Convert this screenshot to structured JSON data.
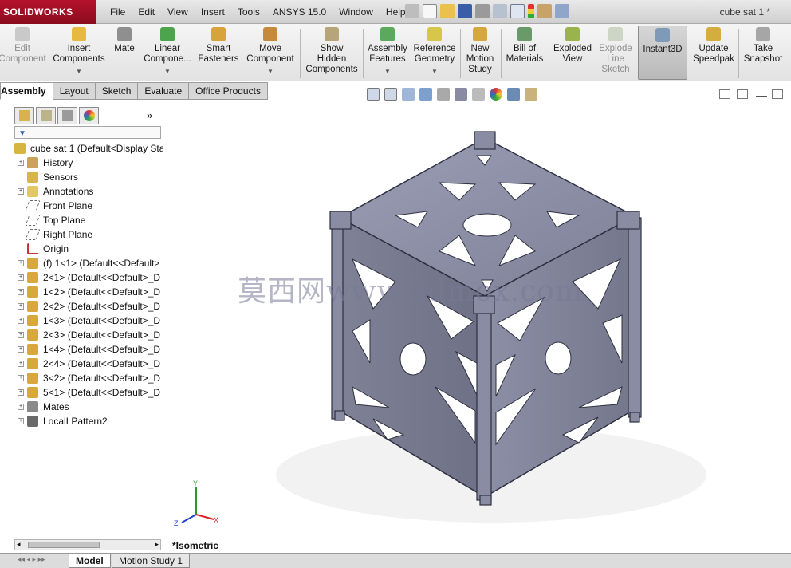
{
  "app": {
    "brand": "SOLIDWORKS",
    "doc_title": "cube sat 1 *"
  },
  "menu": [
    "File",
    "Edit",
    "View",
    "Insert",
    "Tools",
    "ANSYS 15.0",
    "Window",
    "Help"
  ],
  "ribbon": {
    "edit_component": "Edit\nComponent",
    "insert_components": "Insert\nComponents",
    "mate": "Mate",
    "linear_component": "Linear\nCompone...",
    "smart_fasteners": "Smart\nFasteners",
    "move_component": "Move\nComponent",
    "show_hidden": "Show\nHidden\nComponents",
    "assembly_features": "Assembly\nFeatures",
    "reference_geometry": "Reference\nGeometry",
    "new_motion_study": "New\nMotion\nStudy",
    "bill_of_materials": "Bill of\nMaterials",
    "exploded_view": "Exploded\nView",
    "explode_line_sketch": "Explode\nLine\nSketch",
    "instant3d": "Instant3D",
    "update_speedpak": "Update\nSpeedpak",
    "take_snapshot": "Take\nSnapshot"
  },
  "tabs": [
    "Assembly",
    "Layout",
    "Sketch",
    "Evaluate",
    "Office Products"
  ],
  "tree": {
    "root": "cube sat 1  (Default<Display Sta",
    "items": [
      {
        "label": "History",
        "icon": "history-icon",
        "expand": "+"
      },
      {
        "label": "Sensors",
        "icon": "sensor-icon",
        "expand": ""
      },
      {
        "label": "Annotations",
        "icon": "annotation-icon",
        "expand": "+"
      },
      {
        "label": "Front Plane",
        "icon": "plane-icon",
        "expand": ""
      },
      {
        "label": "Top Plane",
        "icon": "plane-icon",
        "expand": ""
      },
      {
        "label": "Right Plane",
        "icon": "plane-icon",
        "expand": ""
      },
      {
        "label": "Origin",
        "icon": "origin-icon",
        "expand": ""
      },
      {
        "label": "(f) 1<1> (Default<<Default>",
        "icon": "part-icon",
        "expand": "+"
      },
      {
        "label": "2<1> (Default<<Default>_D",
        "icon": "part-icon",
        "expand": "+"
      },
      {
        "label": "1<2> (Default<<Default>_D",
        "icon": "part-icon",
        "expand": "+"
      },
      {
        "label": "2<2> (Default<<Default>_D",
        "icon": "part-icon",
        "expand": "+"
      },
      {
        "label": "1<3> (Default<<Default>_D",
        "icon": "part-icon",
        "expand": "+"
      },
      {
        "label": "2<3> (Default<<Default>_D",
        "icon": "part-icon",
        "expand": "+"
      },
      {
        "label": "1<4> (Default<<Default>_D",
        "icon": "part-icon",
        "expand": "+"
      },
      {
        "label": "2<4> (Default<<Default>_D",
        "icon": "part-icon",
        "expand": "+"
      },
      {
        "label": "3<2> (Default<<Default>_D",
        "icon": "part-icon",
        "expand": "+"
      },
      {
        "label": "5<1> (Default<<Default>_D",
        "icon": "part-icon",
        "expand": "+"
      },
      {
        "label": "Mates",
        "icon": "mates-icon",
        "expand": "+"
      },
      {
        "label": "LocalLPattern2",
        "icon": "pattern-icon",
        "expand": "+"
      }
    ]
  },
  "viewport": {
    "view_label": "*Isometric",
    "watermark": "莫西网www.3dmox.com"
  },
  "bottom_tabs": [
    "Model",
    "Motion Study 1"
  ],
  "colors": {
    "accent_red": "#b5122b",
    "part_gray": "#8c8ea6"
  }
}
